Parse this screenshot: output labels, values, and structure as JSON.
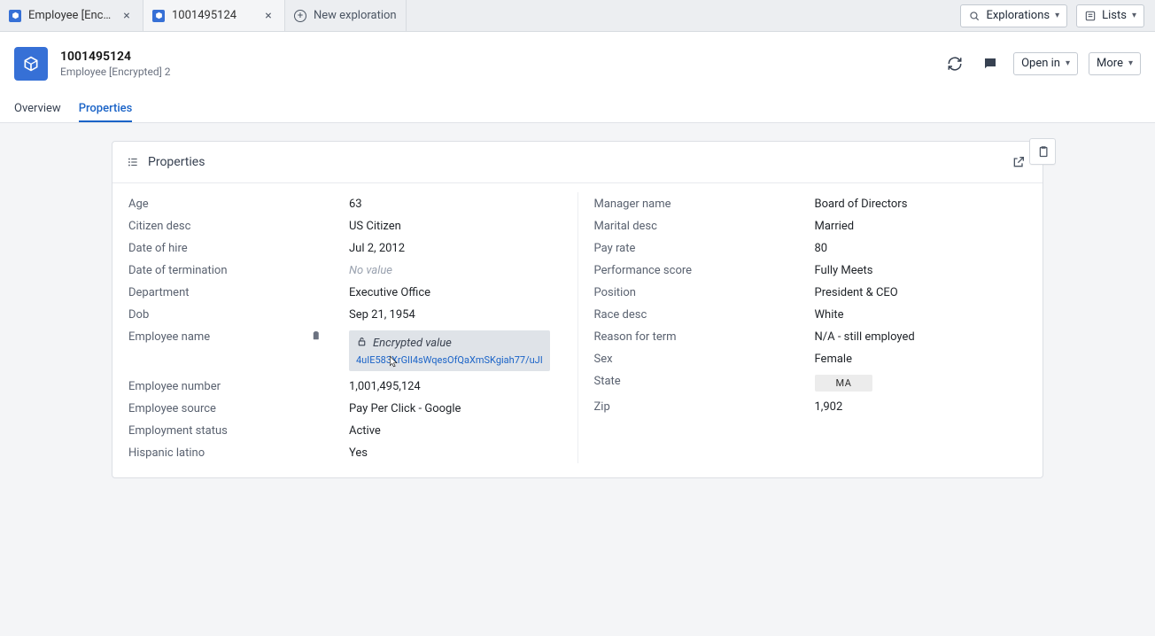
{
  "tabs": {
    "tab1_label": "Employee [Encry…",
    "tab2_label": "1001495124",
    "new_tab_label": "New exploration"
  },
  "top_controls": {
    "explorations_label": "Explorations",
    "lists_label": "Lists"
  },
  "header": {
    "title": "1001495124",
    "subtitle": "Employee [Encrypted] 2",
    "openin_label": "Open in",
    "more_label": "More"
  },
  "subtabs": {
    "overview": "Overview",
    "properties": "Properties"
  },
  "card": {
    "title": "Properties"
  },
  "left": {
    "age_l": "Age",
    "age_v": "63",
    "citizen_l": "Citizen desc",
    "citizen_v": "US Citizen",
    "hire_l": "Date of hire",
    "hire_v": "Jul 2, 2012",
    "term_l": "Date of termination",
    "term_v": "No value",
    "dept_l": "Department",
    "dept_v": "Executive Office",
    "dob_l": "Dob",
    "dob_v": "Sep 21, 1954",
    "ename_l": "Employee name",
    "enc_label": "Encrypted value",
    "enc_hash": "4uIE583XrGlI4sWqesOfQaXmSKgiah77/uJI",
    "enum_l": "Employee number",
    "enum_v": "1,001,495,124",
    "esrc_l": "Employee source",
    "esrc_v": "Pay Per Click - Google",
    "estat_l": "Employment status",
    "estat_v": "Active",
    "hisp_l": "Hispanic latino",
    "hisp_v": "Yes"
  },
  "right": {
    "mgr_l": "Manager name",
    "mgr_v": "Board of Directors",
    "mar_l": "Marital desc",
    "mar_v": "Married",
    "pay_l": "Pay rate",
    "pay_v": "80",
    "perf_l": "Performance score",
    "perf_v": "Fully Meets",
    "pos_l": "Position",
    "pos_v": "President & CEO",
    "race_l": "Race desc",
    "race_v": "White",
    "reason_l": "Reason for term",
    "reason_v": "N/A - still employed",
    "sex_l": "Sex",
    "sex_v": "Female",
    "state_l": "State",
    "state_v": "MA",
    "zip_l": "Zip",
    "zip_v": "1,902"
  }
}
